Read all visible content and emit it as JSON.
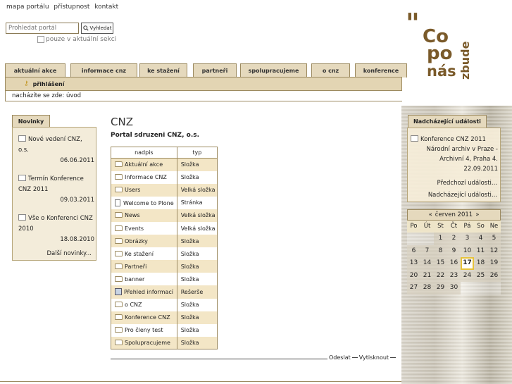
{
  "top_links": [
    "mapa portálu",
    "přístupnost",
    "kontakt"
  ],
  "search": {
    "placeholder": "Prohledat portál",
    "button_label": "Vyhledat",
    "section_only_label": "pouze v aktuální sekci"
  },
  "logo": {
    "line1": "Co",
    "line2": "po",
    "line3": "nás",
    "vertical": "zbude"
  },
  "tabs": [
    "aktuální akce",
    "informace cnz",
    "ke stažení",
    "partneři",
    "spolupracujeme",
    "o cnz",
    "konference"
  ],
  "login_label": "přihlášení",
  "breadcrumb": {
    "prefix": "nacházíte se zde:",
    "current": "úvod"
  },
  "news": {
    "title": "Novinky",
    "items": [
      {
        "title": "Nové vedení CNZ, o.s.",
        "date": "06.06.2011"
      },
      {
        "title": "Termín Konference CNZ 2011",
        "date": "09.03.2011"
      },
      {
        "title": "Vše o Konferenci CNZ 2010",
        "date": "18.08.2010"
      }
    ],
    "more": "Další novinky..."
  },
  "main": {
    "title": "CNZ",
    "subtitle": "Portal sdruzeni CNZ, o.s.",
    "columns": [
      "nadpis",
      "typ"
    ],
    "rows": [
      {
        "title": "Aktuální akce",
        "type": "Složka",
        "icon": "folder-icon"
      },
      {
        "title": "Informace CNZ",
        "type": "Složka",
        "icon": "folder-icon"
      },
      {
        "title": "Users",
        "type": "Velká složka",
        "icon": "folder-icon"
      },
      {
        "title": "Welcome to Plone",
        "type": "Stránka",
        "icon": "page-icon"
      },
      {
        "title": "News",
        "type": "Velká složka",
        "icon": "folder-icon"
      },
      {
        "title": "Events",
        "type": "Velká složka",
        "icon": "folder-icon"
      },
      {
        "title": "Obrázky",
        "type": "Složka",
        "icon": "folder-icon"
      },
      {
        "title": "Ke stažení",
        "type": "Složka",
        "icon": "folder-icon"
      },
      {
        "title": "Partneři",
        "type": "Složka",
        "icon": "folder-icon"
      },
      {
        "title": "banner",
        "type": "Složka",
        "icon": "folder-icon"
      },
      {
        "title": "Přehled informací",
        "type": "Rešerše",
        "icon": "search-icon"
      },
      {
        "title": "o CNZ",
        "type": "Složka",
        "icon": "folder-icon"
      },
      {
        "title": "Konference CNZ",
        "type": "Složka",
        "icon": "folder-icon"
      },
      {
        "title": "Pro členy test",
        "type": "Složka",
        "icon": "folder-icon"
      },
      {
        "title": "Spolupracujeme",
        "type": "Složka",
        "icon": "folder-icon"
      }
    ],
    "actions": [
      "Odeslat",
      "Vytisknout"
    ]
  },
  "events": {
    "title": "Nadcházející události",
    "event_title": "Konference CNZ 2011",
    "event_location": "Národní archiv v Praze - Archivní 4, Praha 4.",
    "event_date": "22.09.2011",
    "previous": "Předchozí události...",
    "upcoming": "Nadcházející události..."
  },
  "calendar": {
    "prev": "«",
    "month": "červen 2011",
    "next": "»",
    "days": [
      "Po",
      "Út",
      "St",
      "Čt",
      "Pá",
      "So",
      "Ne"
    ],
    "weeks": [
      [
        "",
        "",
        "1",
        "2",
        "3",
        "4",
        "5"
      ],
      [
        "6",
        "7",
        "8",
        "9",
        "10",
        "11",
        "12"
      ],
      [
        "13",
        "14",
        "15",
        "16",
        "17",
        "18",
        "19"
      ],
      [
        "20",
        "21",
        "22",
        "23",
        "24",
        "25",
        "26"
      ],
      [
        "27",
        "28",
        "29",
        "30",
        "",
        "",
        ""
      ]
    ],
    "today": "17"
  },
  "colors": {
    "accent": "#e5d9bd",
    "border": "#9c8a60",
    "row_alt": "#f3e6c6",
    "logo": "#7a5a2a"
  }
}
